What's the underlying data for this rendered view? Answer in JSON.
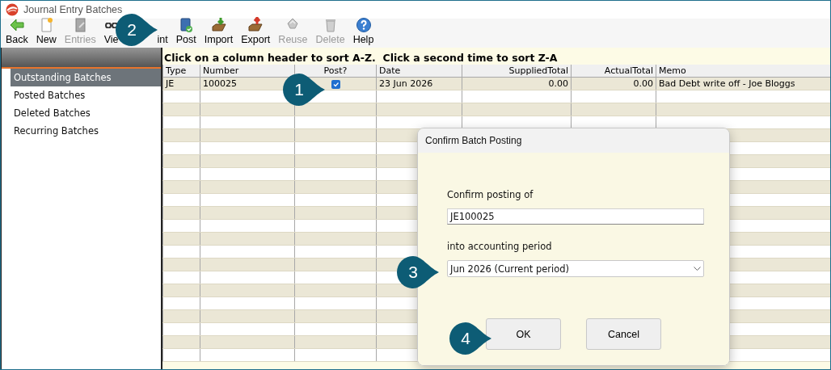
{
  "window": {
    "title": "Journal Entry Batches"
  },
  "toolbar": [
    {
      "label": "Back",
      "kind": "back",
      "disabled": false
    },
    {
      "label": "New",
      "kind": "new",
      "disabled": false
    },
    {
      "label": "Entries",
      "kind": "entries",
      "disabled": true
    },
    {
      "label": "Vie",
      "kind": "view",
      "disabled": false
    },
    {
      "label": "int",
      "kind": "print",
      "disabled": false
    },
    {
      "label": "Post",
      "kind": "post",
      "disabled": false
    },
    {
      "label": "Import",
      "kind": "import",
      "disabled": false
    },
    {
      "label": "Export",
      "kind": "export",
      "disabled": false
    },
    {
      "label": "Reuse",
      "kind": "reuse",
      "disabled": true
    },
    {
      "label": "Delete",
      "kind": "delete",
      "disabled": true
    },
    {
      "label": "Help",
      "kind": "help",
      "disabled": false
    }
  ],
  "sidebar": {
    "items": [
      {
        "label": "Outstanding Batches",
        "selected": true
      },
      {
        "label": "Posted Batches",
        "selected": false
      },
      {
        "label": "Deleted Batches",
        "selected": false
      },
      {
        "label": "Recurring Batches",
        "selected": false
      }
    ]
  },
  "table": {
    "hint": "Click on a column header to sort A-Z.  Click a second time to sort Z-A",
    "columns": [
      {
        "label": "Type",
        "kind": "text"
      },
      {
        "label": "Number",
        "kind": "text"
      },
      {
        "label": "Post?",
        "kind": "check"
      },
      {
        "label": "Date",
        "kind": "text"
      },
      {
        "label": "SuppliedTotal",
        "kind": "number"
      },
      {
        "label": "ActualTotal",
        "kind": "number"
      },
      {
        "label": "Memo",
        "kind": "text"
      }
    ],
    "rows": [
      {
        "cells": [
          "JE",
          "100025",
          {
            "checked": true
          },
          "23 Jun 2026",
          "0.00",
          "0.00",
          "Bad Debt write off - Joe Bloggs"
        ]
      }
    ]
  },
  "dialog": {
    "title": "Confirm Batch Posting",
    "prompt": "Confirm posting of",
    "batch_field": {
      "value": "JE100025"
    },
    "period_label": "into accounting period",
    "period_select": {
      "value": "Jun 2026 (Current period)"
    },
    "buttons": [
      "OK",
      "Cancel"
    ]
  },
  "callouts": [
    {
      "number": "1"
    },
    {
      "number": "2"
    },
    {
      "number": "3"
    },
    {
      "number": "4"
    }
  ]
}
